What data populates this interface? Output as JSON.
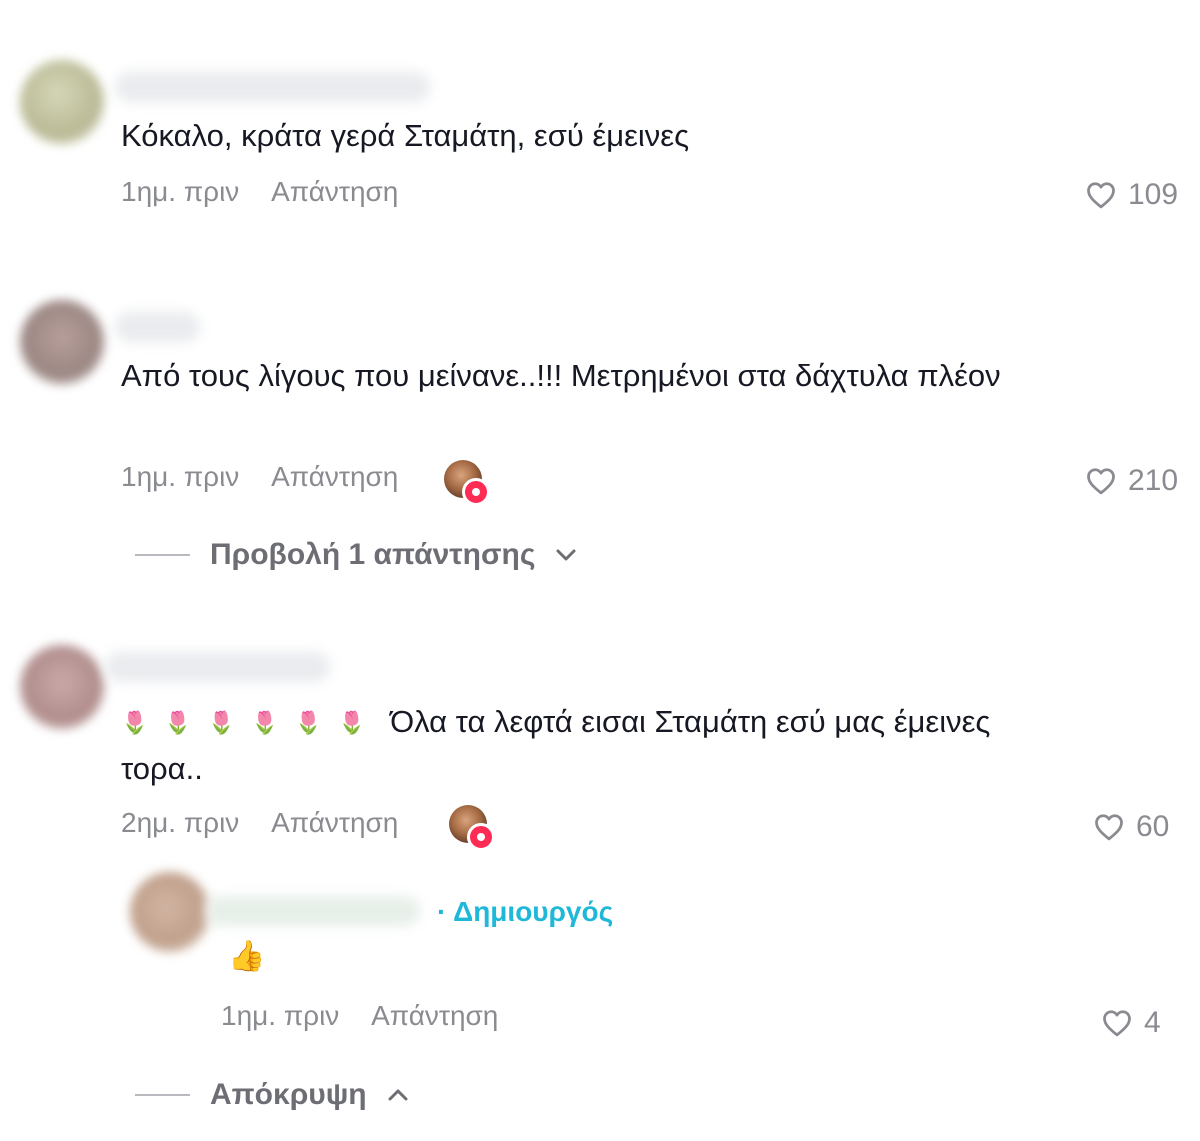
{
  "comments": [
    {
      "text": "Κόκαλο, κράτα γερά Σταμάτη, εσύ έμεινες",
      "time": "1ημ. πριν",
      "reply_label": "Απάντηση",
      "likes": "109"
    },
    {
      "text": "Από τους λίγους που μείνανε..!!! Μετρημένοι στα δάχτυλα πλέον",
      "time": "1ημ. πριν",
      "reply_label": "Απάντηση",
      "likes": "210",
      "view_replies": "Προβολή 1 απάντησης"
    },
    {
      "flowers": [
        "🌷",
        "🌷",
        "🌷",
        "🌷",
        "🌷",
        "🌷"
      ],
      "text": "Όλα τα λεφτά εισαι Σταμάτη εσύ μας έμεινες τορα..",
      "time": "2ημ. πριν",
      "reply_label": "Απάντηση",
      "likes": "60"
    }
  ],
  "reply": {
    "creator_label": "· Δημιουργός",
    "text": "👍",
    "time": "1ημ. πριν",
    "reply_label": "Απάντηση",
    "likes": "4",
    "hide_label": "Απόκρυψη"
  },
  "colors": {
    "accent_creator": "#20b8d8",
    "like_badge": "#fe2c55",
    "meta_gray": "#8a8b91"
  },
  "icons": {
    "like": "heart-outline-icon",
    "chevron_down": "chevron-down-icon",
    "chevron_up": "chevron-up-icon"
  }
}
